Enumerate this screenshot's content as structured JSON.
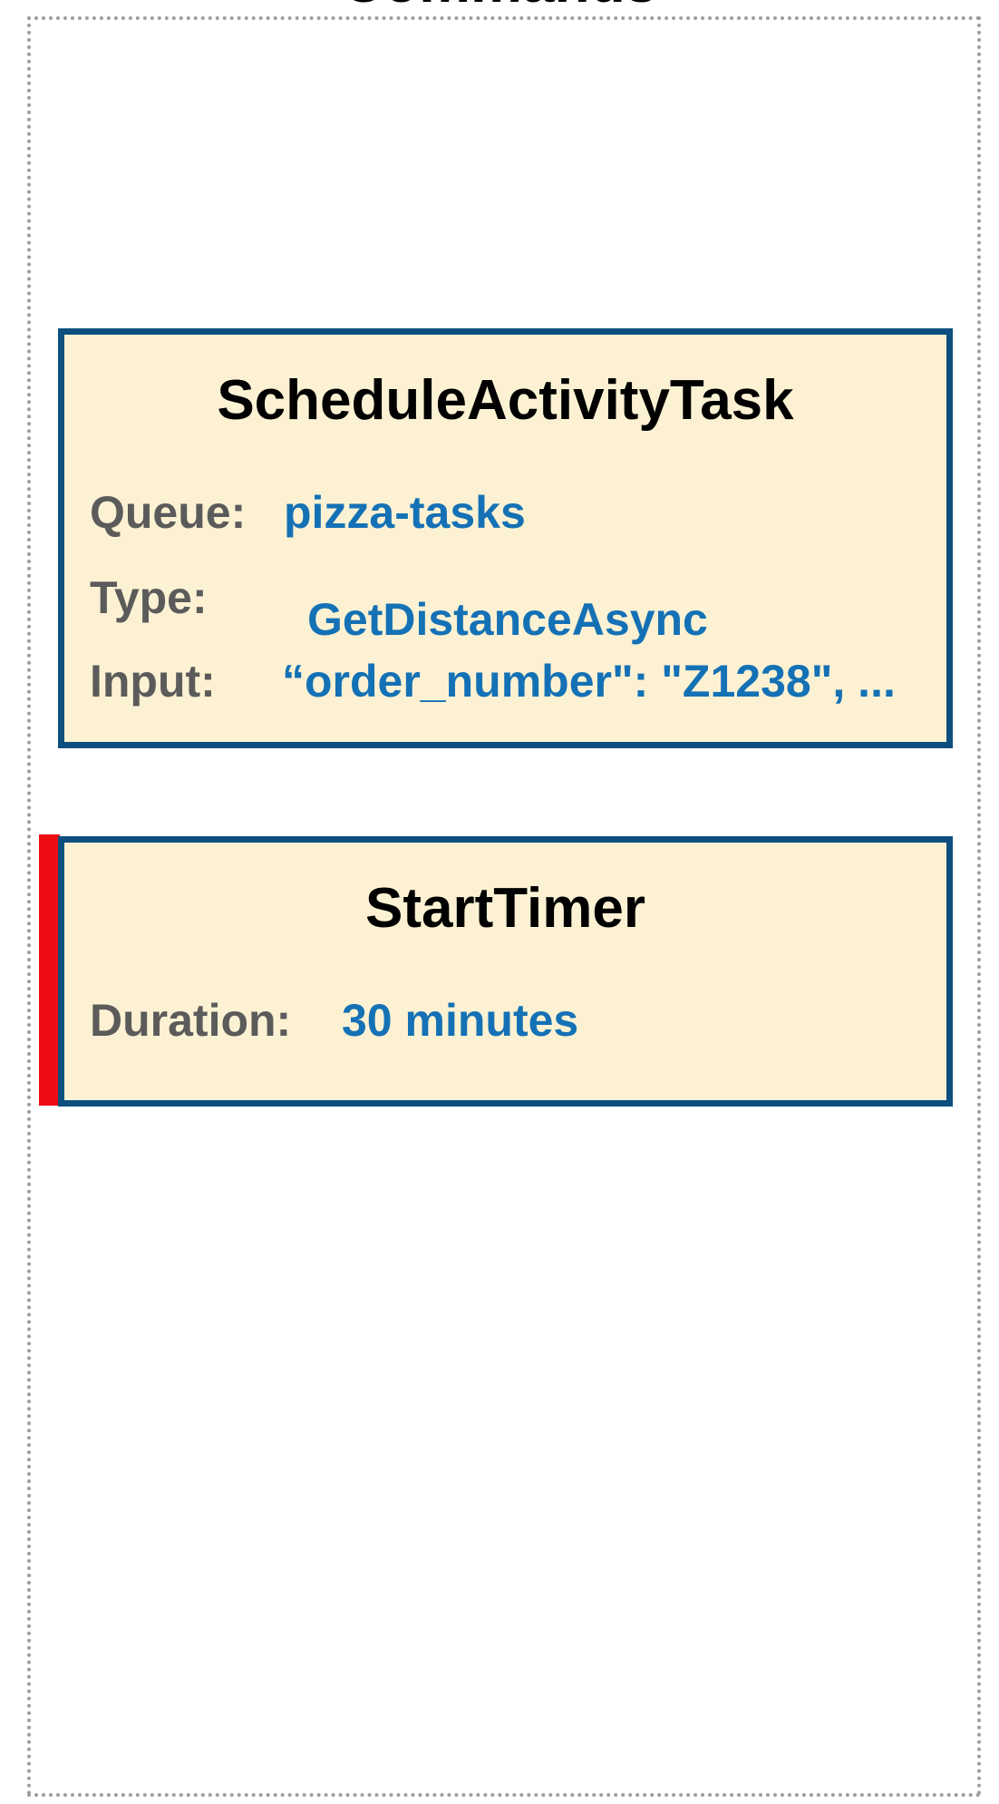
{
  "frame": {
    "title": "Commands"
  },
  "commands": [
    {
      "name": "ScheduleActivityTask",
      "fields": {
        "queue_label": "Queue:",
        "queue_value": "pizza-tasks",
        "type_label": "Type:",
        "type_value": "GetDistanceAsync",
        "input_label": "Input:",
        "input_value": "“order_number\": \"Z1238\", ..."
      }
    },
    {
      "name": "StartTimer",
      "fields": {
        "duration_label": "Duration:",
        "duration_value": "30 minutes"
      }
    }
  ],
  "colors": {
    "card_background": "#fcf2d3",
    "card_border": "#0d4f7e",
    "label": "#5b5b5b",
    "value": "#1571b5",
    "error_marker": "#ef0c13",
    "frame_border": "#9e9e9e"
  }
}
